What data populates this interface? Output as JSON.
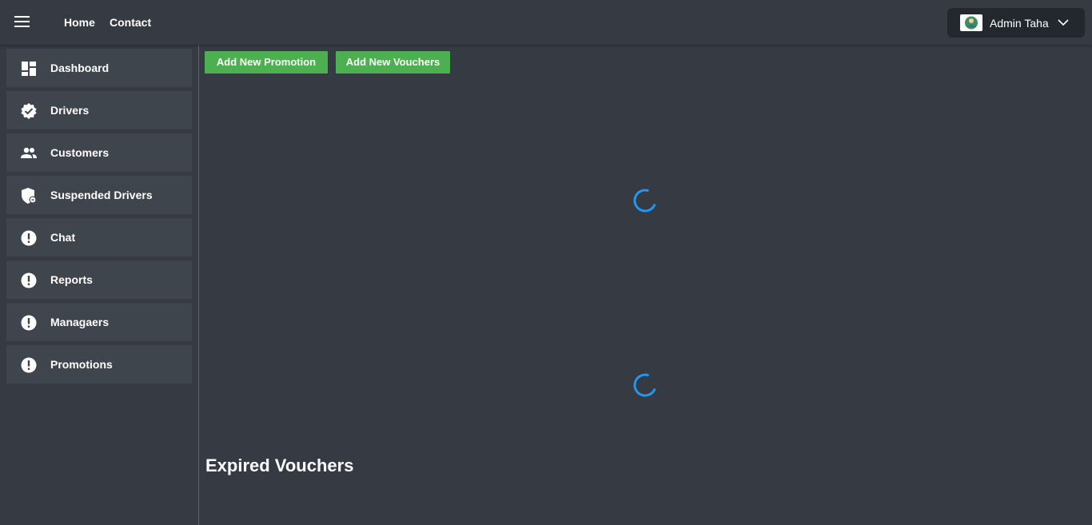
{
  "header": {
    "menu_icon": "hamburger-icon",
    "nav": [
      "Home",
      "Contact"
    ],
    "user": {
      "name": "Admin Taha",
      "avatar_icon": "user-avatar",
      "dropdown_icon": "chevron-down-icon"
    }
  },
  "sidebar": {
    "items": [
      {
        "label": "Dashboard",
        "icon": "dashboard-icon"
      },
      {
        "label": "Drivers",
        "icon": "verified-badge-icon"
      },
      {
        "label": "Customers",
        "icon": "people-icon"
      },
      {
        "label": "Suspended Drivers",
        "icon": "shield-lock-icon"
      },
      {
        "label": "Chat",
        "icon": "alert-circle-icon"
      },
      {
        "label": "Reports",
        "icon": "alert-circle-icon"
      },
      {
        "label": "Managaers",
        "icon": "alert-circle-icon"
      },
      {
        "label": "Promotions",
        "icon": "alert-circle-icon"
      }
    ]
  },
  "main": {
    "buttons": {
      "add_promotion": "Add New Promotion",
      "add_vouchers": "Add New Vouchers"
    },
    "expired_title": "Expired Vouchers"
  },
  "colors": {
    "background": "#353a43",
    "sidebar_item": "#3f454d",
    "button": "#4caf50",
    "spinner": "#2196f3",
    "user_menu": "#23272e"
  }
}
